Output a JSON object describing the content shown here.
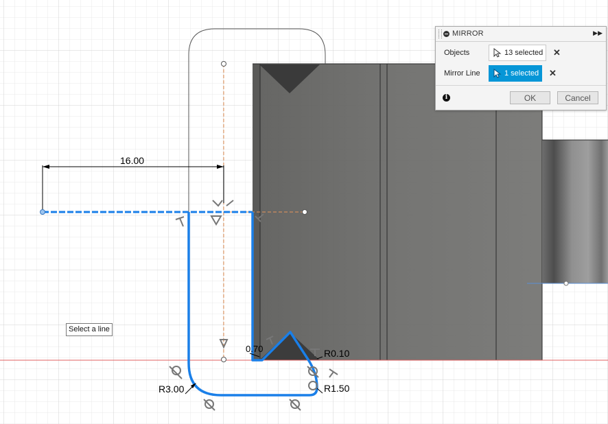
{
  "colors": {
    "selection_blue": "#1a7fe8",
    "body_gray": "#6d6d6b",
    "axis_red": "#e06060",
    "construction_orange": "#e8955a",
    "accent": "#0696d7"
  },
  "sketch": {
    "dimension_width": "16.00",
    "dimension_r3": "R3.00",
    "dimension_r150": "R1.50",
    "dimension_r010": "R0.10",
    "dimension_070": "0.70"
  },
  "tooltip": {
    "text": "Select a line"
  },
  "mirror_panel": {
    "title": "MIRROR",
    "objects_label": "Objects",
    "objects_value": "13 selected",
    "mirror_line_label": "Mirror Line",
    "mirror_line_value": "1 selected",
    "ok_label": "OK",
    "cancel_label": "Cancel",
    "icons": {
      "collapse": "minus-circle-icon",
      "expand": "double-arrow-right-icon",
      "cursor": "arrow-cursor-icon",
      "clear": "close-icon",
      "info": "info-icon"
    }
  }
}
